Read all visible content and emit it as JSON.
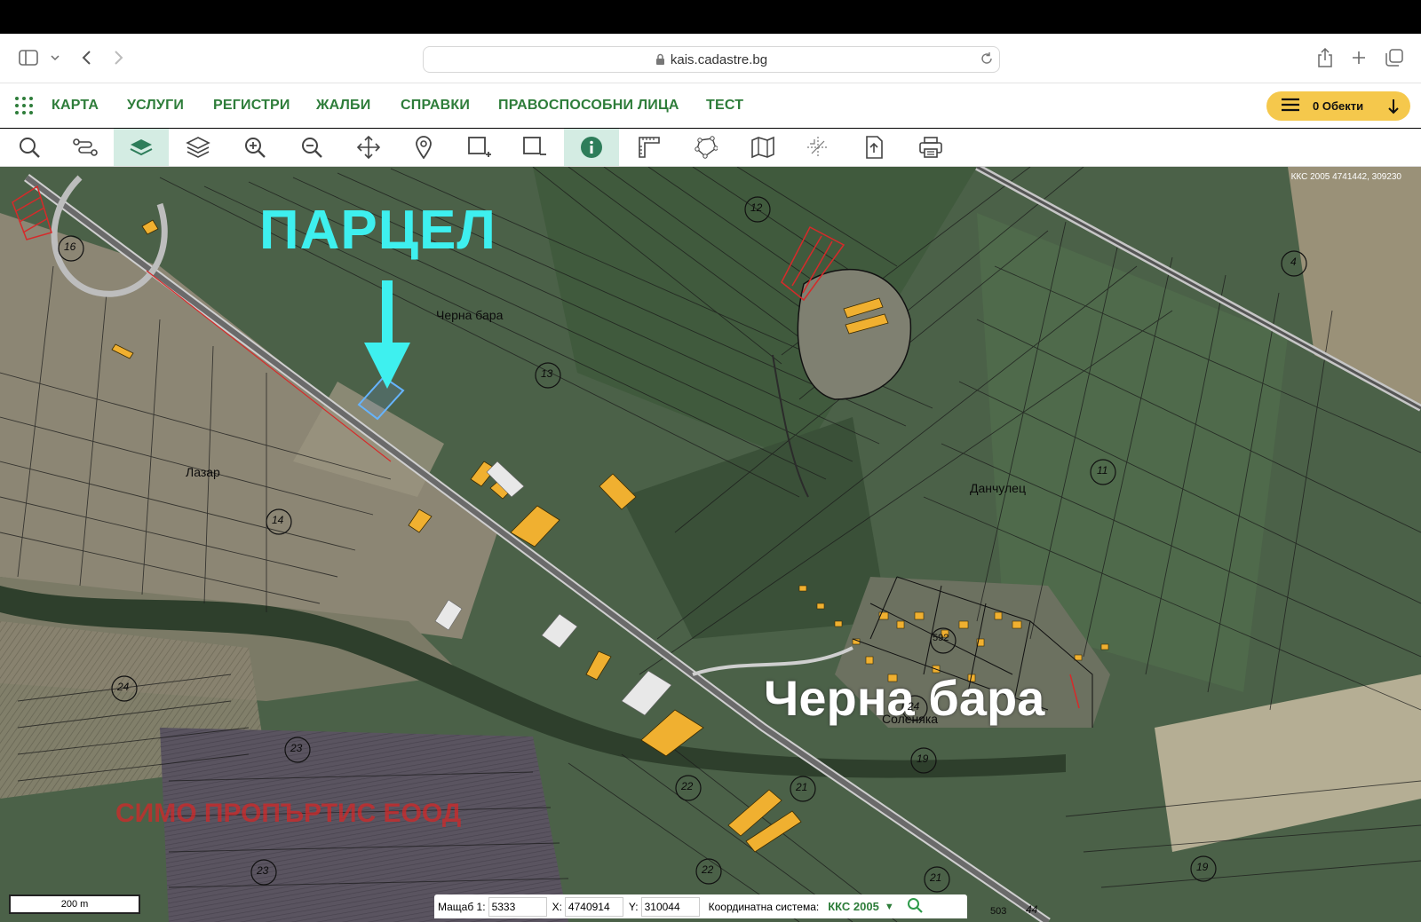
{
  "browser": {
    "url": "kais.cadastre.bg"
  },
  "nav": {
    "items": [
      "КАРТА",
      "УСЛУГИ",
      "РЕГИСТРИ",
      "ЖАЛБИ",
      "СПРАВКИ",
      "ПРАВОСПОСОБНИ ЛИЦА",
      "ТЕСТ"
    ],
    "objects_label": "0 Обекти",
    "accent_color": "#2e7d3a",
    "objects_button_color": "#f5c84c"
  },
  "toolbar": {
    "tools": [
      "search-icon",
      "route-icon",
      "base-layer-icon",
      "layers-icon",
      "zoom-in-icon",
      "zoom-out-icon",
      "pan-icon",
      "pin-icon",
      "select-add-icon",
      "select-remove-icon",
      "info-icon",
      "measure-icon",
      "polygon-icon",
      "map-icon",
      "crosshair-icon",
      "export-icon",
      "print-icon"
    ]
  },
  "map": {
    "coords_readout": "ККС 2005 4741442, 309230",
    "annotations": {
      "parcel": "ПАРЦЕЛ",
      "village": "Черна бара",
      "owner": "СИМО ПРОПЪРТИС ЕООД"
    },
    "place_labels": [
      "Черна бара",
      "Лазар",
      "Данчулец",
      "Соленяка"
    ],
    "area_numbers": [
      "16",
      "12",
      "13",
      "4",
      "14",
      "11",
      "24",
      "23",
      "22",
      "21",
      "19",
      "23",
      "22",
      "21",
      "19",
      "44",
      "503",
      "24",
      "592"
    ],
    "scale_label": "200 m"
  },
  "coordbar": {
    "scale_label": "Мащаб 1:",
    "scale_value": "5333",
    "x_label": "X:",
    "x_value": "4740914",
    "y_label": "Y:",
    "y_value": "310044",
    "system_label": "Координатна система:",
    "system_value": "ККС 2005"
  }
}
